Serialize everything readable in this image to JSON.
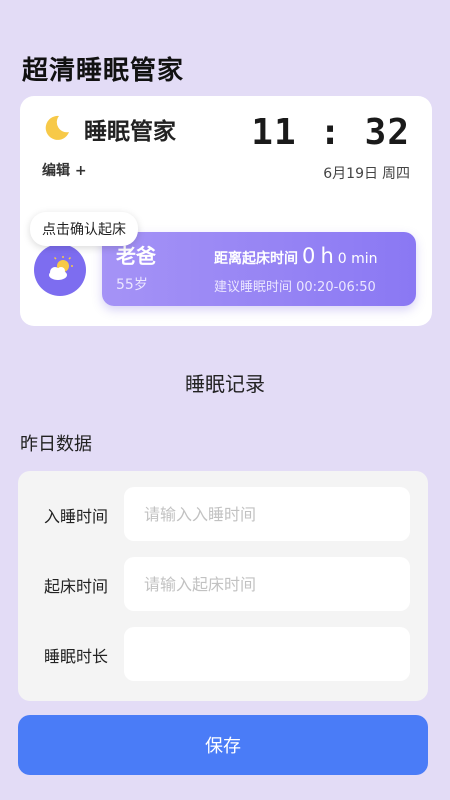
{
  "app_title": "超清睡眠管家",
  "card": {
    "title": "睡眠管家",
    "clock": "11 : 32",
    "date": "6月19日",
    "weekday": "周四",
    "edit_label": "编辑 +"
  },
  "tooltip": "点击确认起床",
  "person": {
    "name": "老爸",
    "age": "55岁",
    "countdown_label": "距离起床时间",
    "hours": "0",
    "hours_unit": "h",
    "minutes": "0 min",
    "suggestion": "建议睡眠时间 00:20-06:50"
  },
  "section_title": "睡眠记录",
  "sub_title": "昨日数据",
  "form": {
    "fields": [
      {
        "label": "入睡时间",
        "placeholder": "请输入入睡时间"
      },
      {
        "label": "起床时间",
        "placeholder": "请输入起床时间"
      },
      {
        "label": "睡眠时长",
        "placeholder": ""
      }
    ]
  },
  "save_label": "保存",
  "colors": {
    "background": "#e3dcf6",
    "accent_purple": "#8a78f3",
    "button_blue": "#4a7cf7",
    "moon_yellow": "#f7c948"
  },
  "icons": {
    "moon": "moon-zz-icon",
    "weather": "partly-cloudy-icon"
  }
}
